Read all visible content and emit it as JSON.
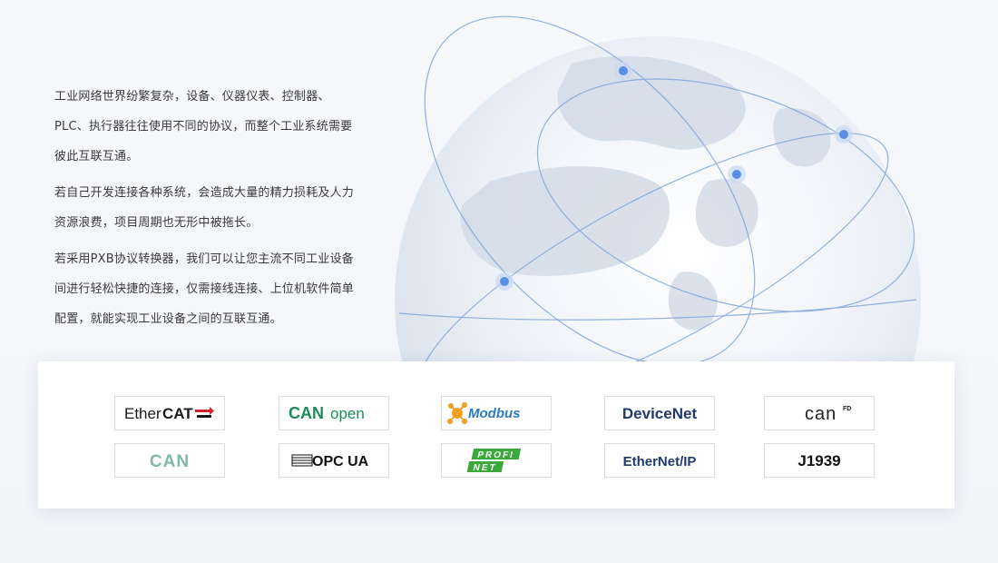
{
  "intro": {
    "paragraphs": [
      "工业网络世界纷繁复杂，设备、仪器仪表、控制器、PLC、执行器往往使用不同的协议，而整个工业系统需要彼此互联互通。",
      "若自己开发连接各种系统，会造成大量的精力损耗及人力资源浪费，项目周期也无形中被拖长。",
      "若采用PXB协议转换器，我们可以让您主流不同工业设备间进行轻松快捷的连接，仅需接线连接、上位机软件简单配置，就能实现工业设备之间的互联互通。"
    ]
  },
  "protocols": {
    "ethercat": {
      "text_a": "Ether",
      "text_b": "CAT",
      "color_text": "#1a1a1a",
      "color_arrow": "#d6202a"
    },
    "canopen": {
      "text_a": "CAN",
      "text_b": "open",
      "color": "#1c8a5a"
    },
    "modbus": {
      "text": "Modbus",
      "color": "#2a7bbf",
      "icon_color": "#f0a020"
    },
    "devicenet": {
      "text": "DeviceNet",
      "color": "#1e3a6e"
    },
    "canfd": {
      "text": "can",
      "sup": "FD",
      "color": "#222222"
    },
    "can": {
      "text": "CAN",
      "color": "#7fb8a4"
    },
    "opcua": {
      "text": "OPC UA",
      "color": "#111111"
    },
    "profinet": {
      "text_a": "PROFI",
      "text_b": "NET",
      "color": "#3aa83a"
    },
    "ethernetip": {
      "text": "EtherNet/IP",
      "color": "#1e3a6e"
    },
    "j1939": {
      "text": "J1939",
      "color": "#111111"
    }
  },
  "colors": {
    "orbit": "#7aa0d8",
    "node": "#5a8fe6",
    "node_halo": "#c8d8f2"
  }
}
